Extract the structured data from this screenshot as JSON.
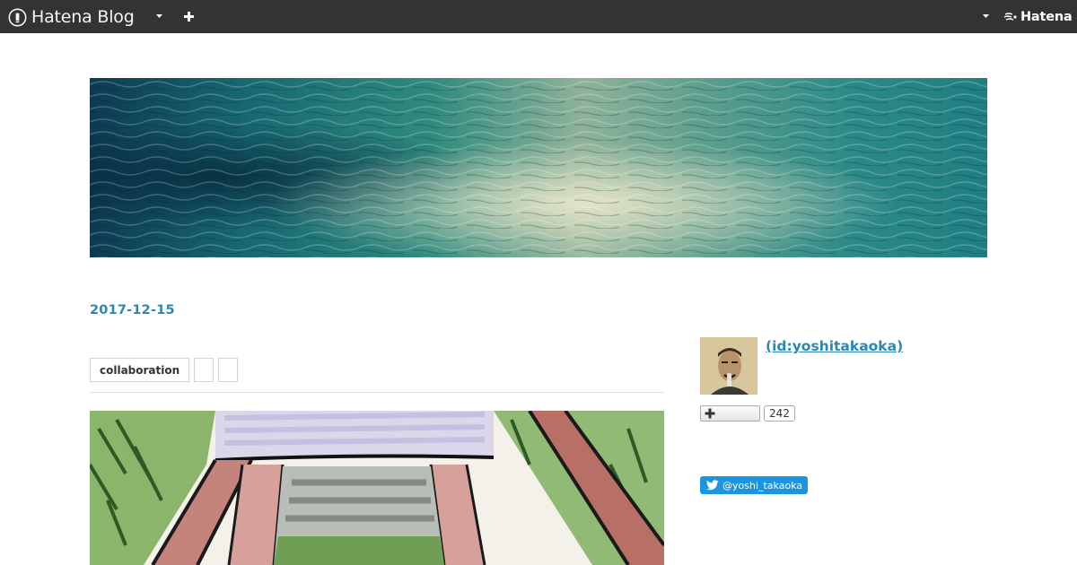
{
  "topbar": {
    "brand": "Hatena Blog",
    "service": "Hatena",
    "icons": {
      "brand": "hatena-blog-logo-icon",
      "blog_menu": "chevron-down-icon",
      "new_post": "plus-icon",
      "account_menu": "chevron-down-icon",
      "service_logo": "hatena-logo-icon"
    }
  },
  "header": {
    "image": "water-surface-photo"
  },
  "entry": {
    "date": "2017-12-15",
    "categories": [
      "collaboration",
      "",
      ""
    ],
    "illustration": "marker-sketch-of-wooden-gate"
  },
  "sidebar": {
    "profile_name": " (id:yoshitakaoka)",
    "avatar": "profile-photo",
    "subscribe_icon": "plus-icon",
    "subscriber_count": "242",
    "twitter_handle": "@yoshi_takaoka",
    "twitter_icon": "twitter-bird-icon"
  },
  "colors": {
    "topbar_bg": "#333333",
    "link": "#2b87b6",
    "twitter": "#1b95e0",
    "divider": "#dedede"
  }
}
